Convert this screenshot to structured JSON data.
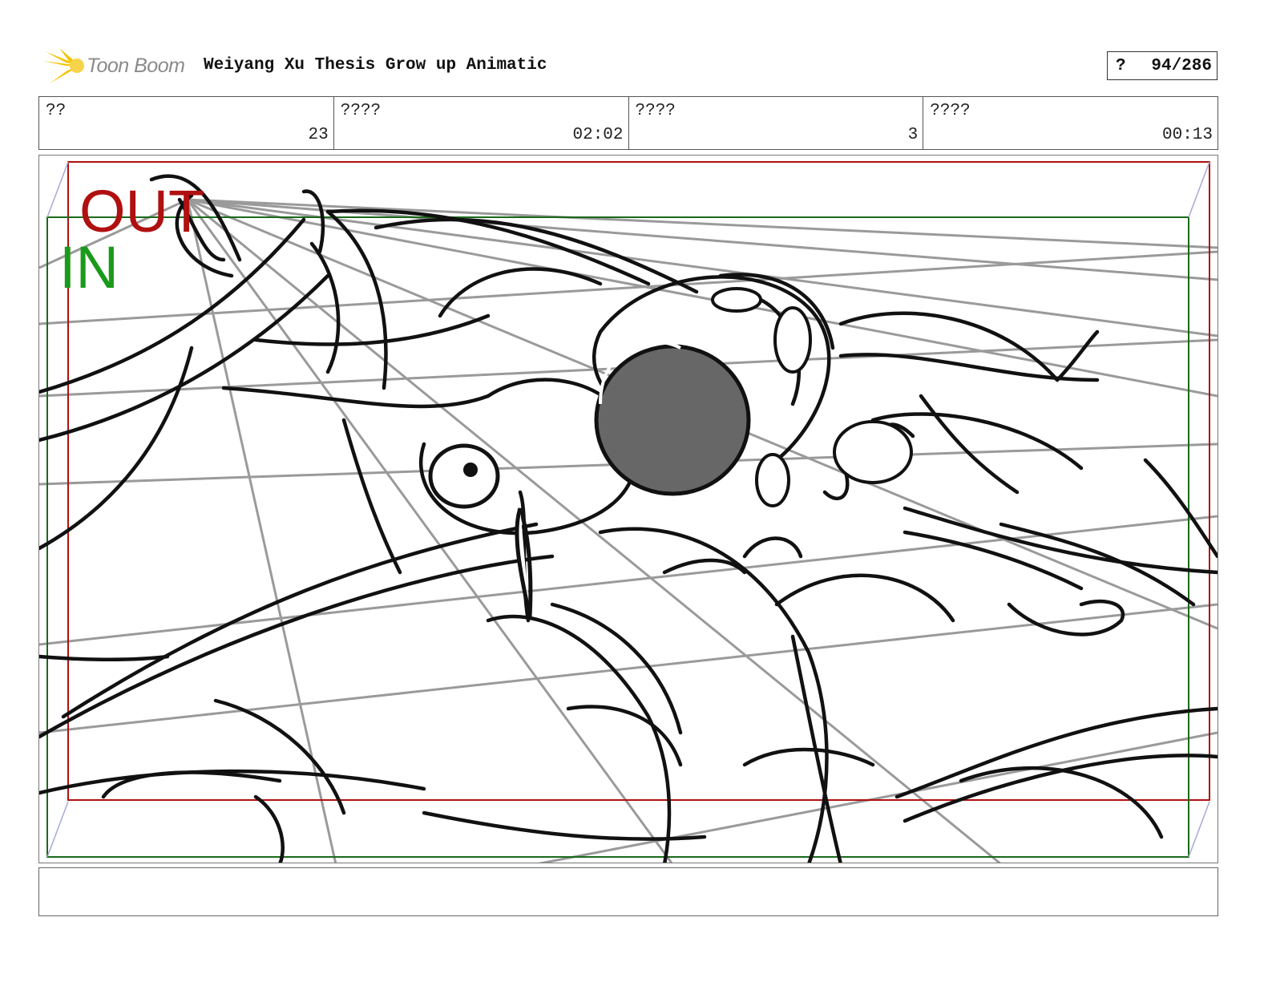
{
  "header": {
    "logo_text": "Toon Boom",
    "title": "Weiyang Xu Thesis Grow up Animatic",
    "page_prefix": "?",
    "page_number": "94/286"
  },
  "info": [
    {
      "label": "??",
      "value": "23"
    },
    {
      "label": "????",
      "value": "02:02"
    },
    {
      "label": "????",
      "value": "3"
    },
    {
      "label": "????",
      "value": "00:13"
    }
  ],
  "frame": {
    "out_label": "OUT",
    "in_label": "IN",
    "out_color": "#b01010",
    "in_color": "#1a8a1a",
    "icon": "storyboard-sketch"
  },
  "notes": {
    "text": ""
  },
  "colors": {
    "logo_flare": "#f5c400",
    "logo_text": "#8a8a8a"
  }
}
